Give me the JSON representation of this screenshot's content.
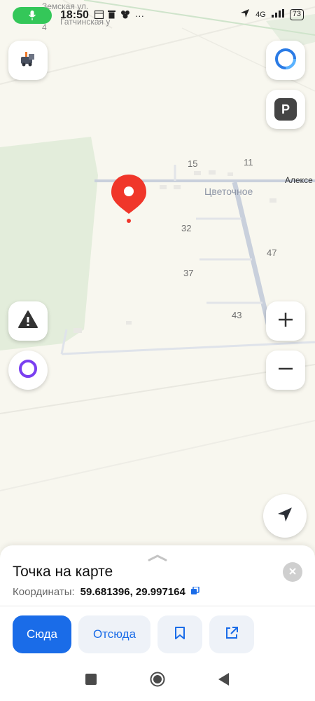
{
  "status_bar": {
    "time": "18:50",
    "network": "4G",
    "battery": "73",
    "more": "···"
  },
  "map": {
    "labels": {
      "n15": "15",
      "n11": "11",
      "n32": "32",
      "n47": "47",
      "n37": "37",
      "n43": "43",
      "place": "Цветочное",
      "road": "Алексе",
      "street1": "Земская ул.",
      "street2": "Гатчинская у",
      "n4": "4"
    },
    "buttons": {
      "parking_label": "P"
    }
  },
  "card": {
    "title": "Точка на карте",
    "coords_label": "Координаты:",
    "coords_value": "59.681396, 29.997164",
    "actions": {
      "here": "Сюда",
      "from_here": "Отсюда"
    }
  },
  "colors": {
    "accent": "#1a6ce8",
    "pin": "#f0362a",
    "alice": "#7a3ff0"
  }
}
